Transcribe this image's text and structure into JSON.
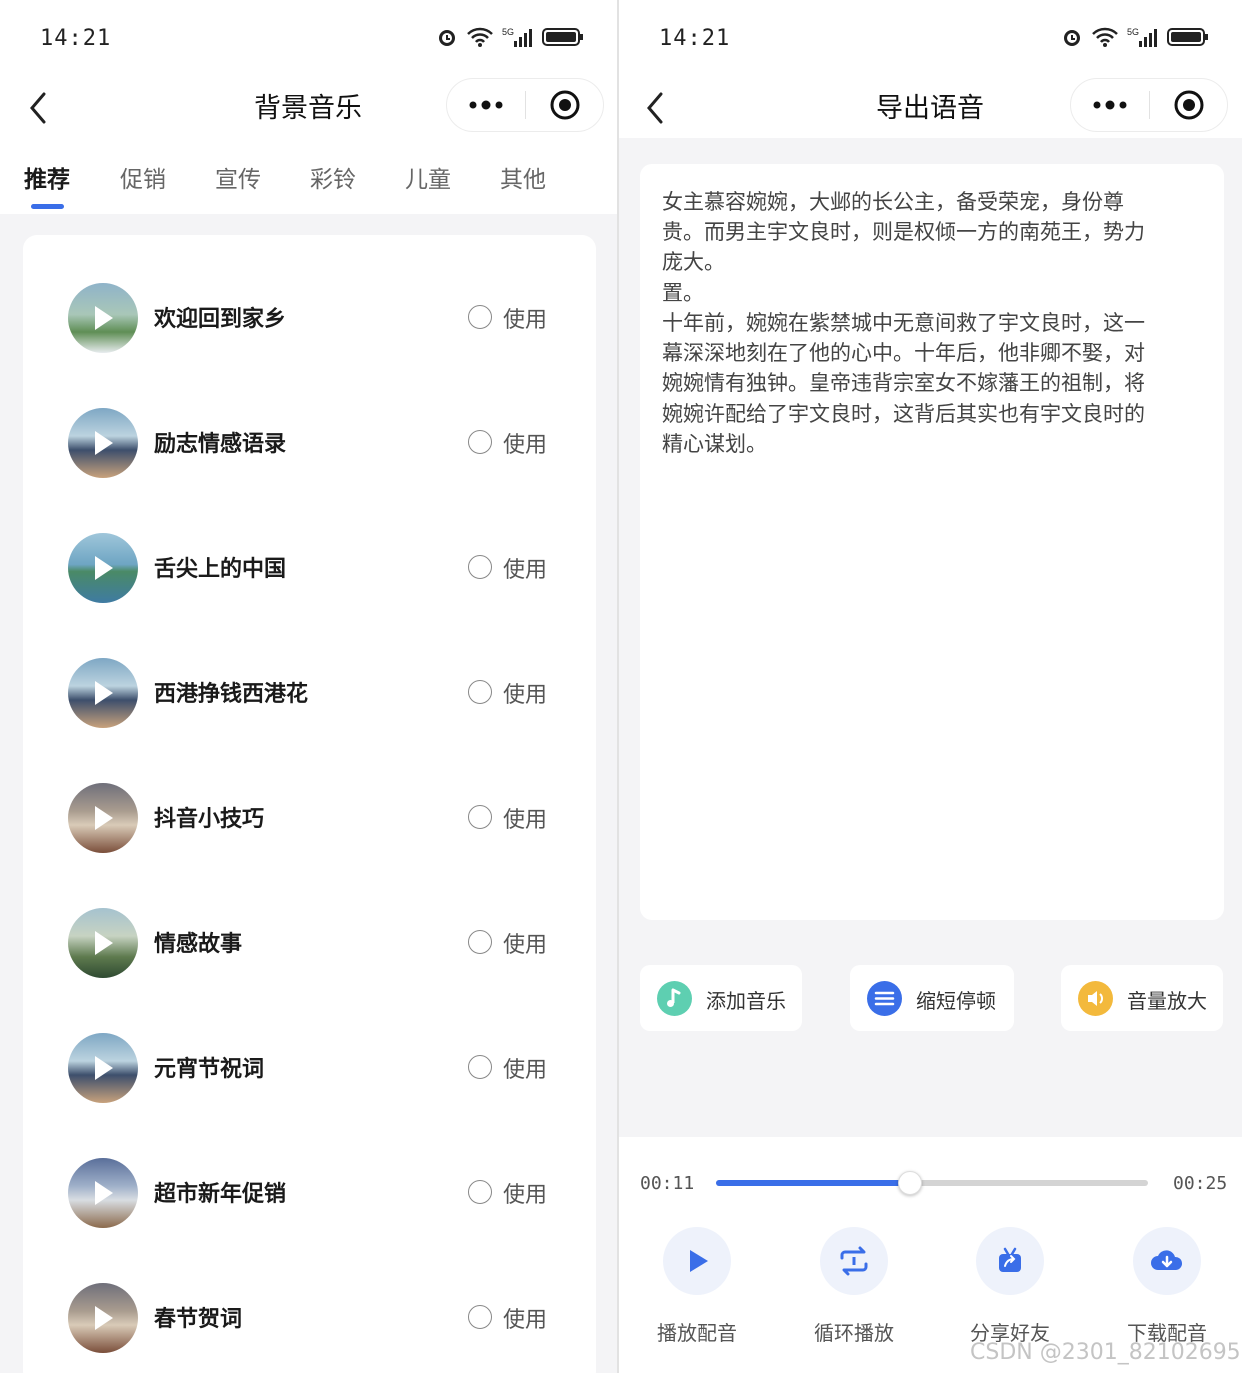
{
  "left": {
    "status_time": "14:21",
    "title": "背景音乐",
    "tabs": [
      {
        "label": "推荐",
        "active": true
      },
      {
        "label": "促销",
        "active": false
      },
      {
        "label": "宣传",
        "active": false
      },
      {
        "label": "彩铃",
        "active": false
      },
      {
        "label": "儿童",
        "active": false
      },
      {
        "label": "其他",
        "active": false
      }
    ],
    "items": [
      {
        "title": "欢迎回到家乡",
        "action": "使用"
      },
      {
        "title": "励志情感语录",
        "action": "使用"
      },
      {
        "title": "舌尖上的中国",
        "action": "使用"
      },
      {
        "title": "西港挣钱西港花",
        "action": "使用"
      },
      {
        "title": "抖音小技巧",
        "action": "使用"
      },
      {
        "title": "情感故事",
        "action": "使用"
      },
      {
        "title": "元宵节祝词",
        "action": "使用"
      },
      {
        "title": "超市新年促销",
        "action": "使用"
      },
      {
        "title": "春节贺词",
        "action": "使用"
      }
    ]
  },
  "right": {
    "status_time": "14:21",
    "title": "导出语音",
    "text_lines": [
      "女主慕容婉婉，大邺的长公主，备受荣宠，身份尊",
      "贵。而男主宇文良时，则是权倾一方的南苑王，势力",
      "庞大。",
      "置。",
      "十年前，婉婉在紫禁城中无意间救了宇文良时，这一",
      "幕深深地刻在了他的心中。十年后，他非卿不娶，对",
      "婉婉情有独钟。皇帝违背宗室女不嫁藩王的祖制，将",
      "婉婉许配给了宇文良时，这背后其实也有宇文良时的",
      "精心谋划。"
    ],
    "tools": [
      {
        "label": "添加音乐",
        "icon": "music-note-icon",
        "color": "#5ecfb1"
      },
      {
        "label": "缩短停顿",
        "icon": "lines-icon",
        "color": "#3a6ee8"
      },
      {
        "label": "音量放大",
        "icon": "speaker-icon",
        "color": "#f3b93c"
      }
    ],
    "player": {
      "current": "00:11",
      "total": "00:25",
      "progress": 0.45
    },
    "actions": [
      {
        "label": "播放配音",
        "icon": "play-icon"
      },
      {
        "label": "循环播放",
        "icon": "repeat-icon"
      },
      {
        "label": "分享好友",
        "icon": "share-icon"
      },
      {
        "label": "下载配音",
        "icon": "download-icon"
      }
    ]
  },
  "watermark": "CSDN @2301_82102695",
  "colors": {
    "accent": "#3a6ee8",
    "background": "#f4f4f6"
  }
}
